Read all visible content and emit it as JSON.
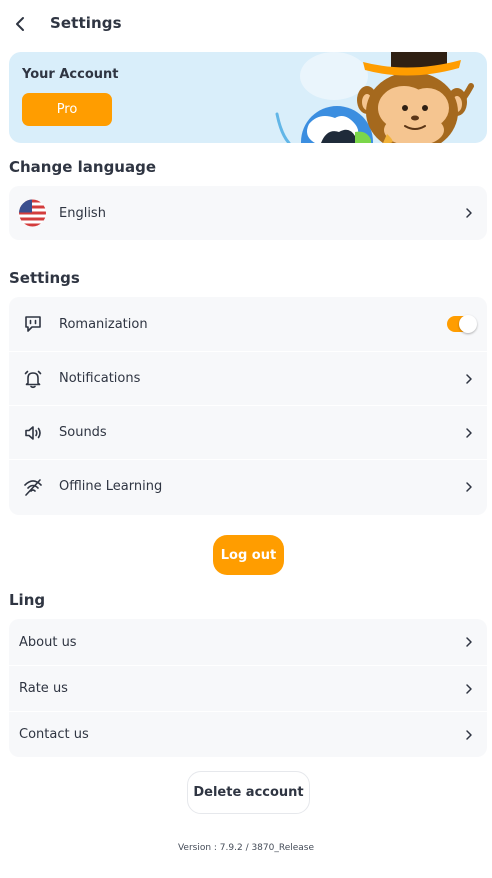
{
  "header": {
    "title": "Settings",
    "back_icon": "chevron-left-icon"
  },
  "account": {
    "title": "Your Account",
    "plan_button": "Pro"
  },
  "language_section": {
    "title": "Change language",
    "current_language": "English",
    "flag_icon": "us-flag-icon"
  },
  "settings_section": {
    "title": "Settings",
    "items": [
      {
        "label": "Romanization",
        "icon": "speech-bubble-icon",
        "control": "toggle",
        "enabled": true
      },
      {
        "label": "Notifications",
        "icon": "bell-icon",
        "control": "chevron"
      },
      {
        "label": "Sounds",
        "icon": "speaker-icon",
        "control": "chevron"
      },
      {
        "label": "Offline Learning",
        "icon": "wifi-off-icon",
        "control": "chevron"
      }
    ]
  },
  "logout_label": "Log out",
  "ling_section": {
    "title": "Ling",
    "items": [
      {
        "label": "About us"
      },
      {
        "label": "Rate us"
      },
      {
        "label": "Contact us"
      }
    ]
  },
  "delete_label": "Delete account",
  "version": "Version : 7.9.2 / 3870_Release",
  "colors": {
    "accent": "#ff9d00",
    "card_bg": "#f7f8fa",
    "account_bg": "#d9eefa",
    "text": "#2f3542"
  }
}
